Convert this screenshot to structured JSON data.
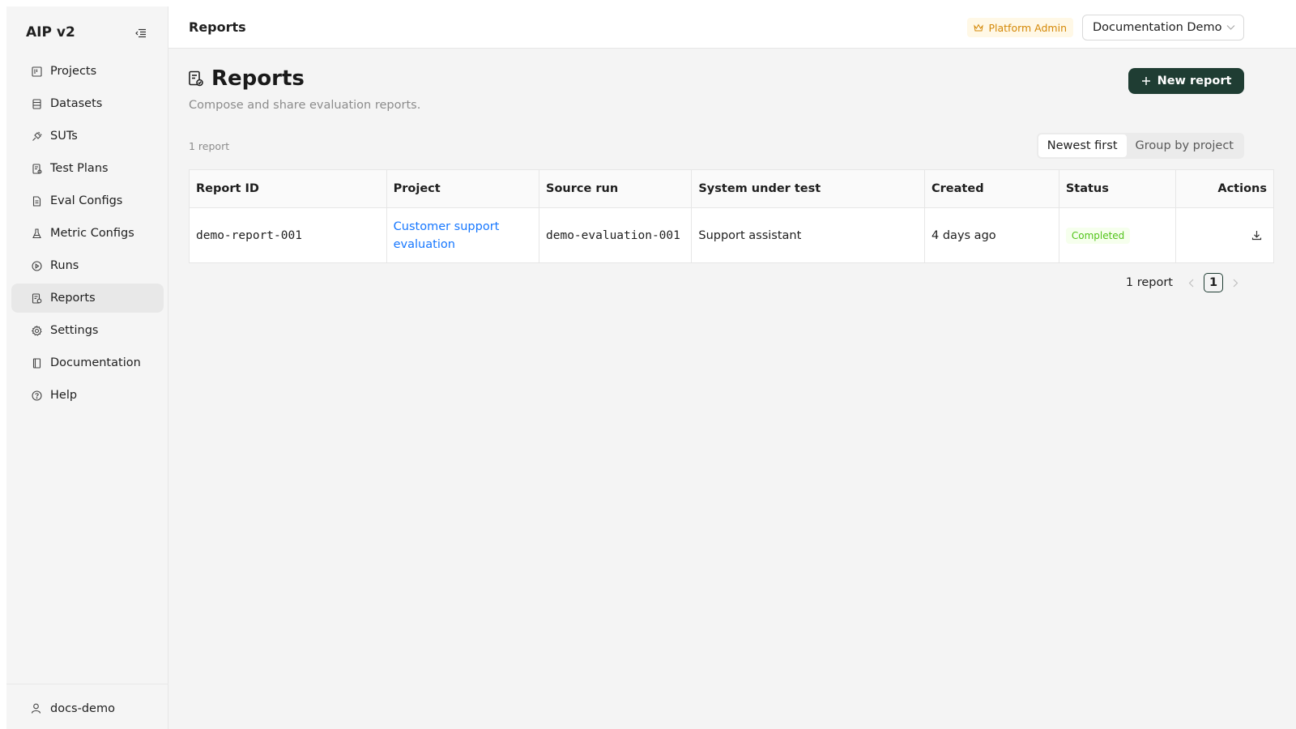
{
  "app": {
    "name": "AIP v2"
  },
  "sidebar": {
    "items": [
      {
        "label": "Projects",
        "icon": "project-board-icon"
      },
      {
        "label": "Datasets",
        "icon": "database-icon"
      },
      {
        "label": "SUTs",
        "icon": "plug-icon"
      },
      {
        "label": "Test Plans",
        "icon": "test-plan-icon"
      },
      {
        "label": "Eval Configs",
        "icon": "file-config-icon"
      },
      {
        "label": "Metric Configs",
        "icon": "flask-icon"
      },
      {
        "label": "Runs",
        "icon": "play-circle-icon"
      },
      {
        "label": "Reports",
        "icon": "report-icon",
        "active": true
      },
      {
        "label": "Settings",
        "icon": "gear-icon"
      },
      {
        "label": "Documentation",
        "icon": "book-icon"
      },
      {
        "label": "Help",
        "icon": "help-circle-icon"
      }
    ],
    "user": "docs-demo"
  },
  "header": {
    "title": "Reports",
    "role_badge": "Platform Admin",
    "workspace": "Documentation Demo"
  },
  "page": {
    "title": "Reports",
    "subtitle": "Compose and share evaluation reports.",
    "new_button": "New report",
    "count": "1 report",
    "sort_options": [
      "Newest first",
      "Group by project"
    ],
    "active_sort": "Newest first"
  },
  "table": {
    "columns": [
      "Report ID",
      "Project",
      "Source run",
      "System under test",
      "Created",
      "Status",
      "Actions"
    ],
    "rows": [
      {
        "report_id": "demo-report-001",
        "project": "Customer support evaluation",
        "source_run": "demo-evaluation-001",
        "sut": "Support assistant",
        "created": "4 days ago",
        "status": "Completed"
      }
    ]
  },
  "pagination": {
    "total": "1 report",
    "current": "1"
  },
  "colors": {
    "accent": "#1f3d33",
    "link": "#1677ff",
    "badge": "#d48806",
    "success": "#52c41a"
  }
}
